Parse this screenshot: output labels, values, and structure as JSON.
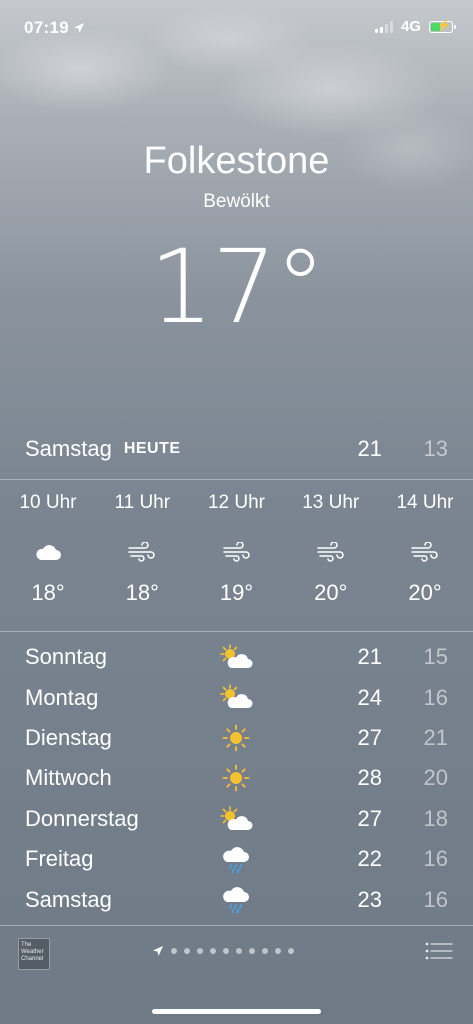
{
  "status_bar": {
    "time": "07:19",
    "network": "4G"
  },
  "header": {
    "city": "Folkestone",
    "condition": "Bewölkt",
    "temperature": "17°"
  },
  "today": {
    "day": "Samstag",
    "badge": "HEUTE",
    "high": "21",
    "low": "13"
  },
  "hourly": [
    {
      "label": "10 Uhr",
      "icon": "cloud-icon",
      "temp": "18°"
    },
    {
      "label": "11 Uhr",
      "icon": "wind-icon",
      "temp": "18°"
    },
    {
      "label": "12 Uhr",
      "icon": "wind-icon",
      "temp": "19°"
    },
    {
      "label": "13 Uhr",
      "icon": "wind-icon",
      "temp": "20°"
    },
    {
      "label": "14 Uhr",
      "icon": "wind-icon",
      "temp": "20°"
    }
  ],
  "daily": [
    {
      "day": "Sonntag",
      "icon": "partly-cloudy-icon",
      "high": "21",
      "low": "15"
    },
    {
      "day": "Montag",
      "icon": "partly-cloudy-icon",
      "high": "24",
      "low": "16"
    },
    {
      "day": "Dienstag",
      "icon": "sun-icon",
      "high": "27",
      "low": "21"
    },
    {
      "day": "Mittwoch",
      "icon": "sun-icon",
      "high": "28",
      "low": "20"
    },
    {
      "day": "Donnerstag",
      "icon": "partly-cloudy-icon",
      "high": "27",
      "low": "18"
    },
    {
      "day": "Freitag",
      "icon": "rain-cloud-icon",
      "high": "22",
      "low": "16"
    },
    {
      "day": "Samstag",
      "icon": "rain-cloud-icon",
      "high": "23",
      "low": "16"
    }
  ],
  "footer": {
    "logo_text": "The Weather Channel",
    "page_count": 10
  },
  "colors": {
    "sun": "#f6c12e",
    "rain": "#4aa3e8",
    "battery": "#4cd964"
  }
}
